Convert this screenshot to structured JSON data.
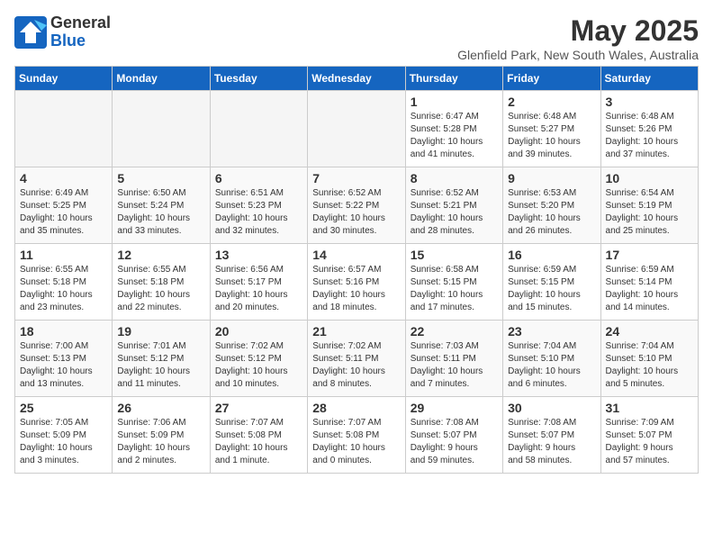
{
  "logo": {
    "general": "General",
    "blue": "Blue"
  },
  "title": "May 2025",
  "location": "Glenfield Park, New South Wales, Australia",
  "days_of_week": [
    "Sunday",
    "Monday",
    "Tuesday",
    "Wednesday",
    "Thursday",
    "Friday",
    "Saturday"
  ],
  "weeks": [
    [
      {
        "day": "",
        "info": ""
      },
      {
        "day": "",
        "info": ""
      },
      {
        "day": "",
        "info": ""
      },
      {
        "day": "",
        "info": ""
      },
      {
        "day": "1",
        "info": "Sunrise: 6:47 AM\nSunset: 5:28 PM\nDaylight: 10 hours\nand 41 minutes."
      },
      {
        "day": "2",
        "info": "Sunrise: 6:48 AM\nSunset: 5:27 PM\nDaylight: 10 hours\nand 39 minutes."
      },
      {
        "day": "3",
        "info": "Sunrise: 6:48 AM\nSunset: 5:26 PM\nDaylight: 10 hours\nand 37 minutes."
      }
    ],
    [
      {
        "day": "4",
        "info": "Sunrise: 6:49 AM\nSunset: 5:25 PM\nDaylight: 10 hours\nand 35 minutes."
      },
      {
        "day": "5",
        "info": "Sunrise: 6:50 AM\nSunset: 5:24 PM\nDaylight: 10 hours\nand 33 minutes."
      },
      {
        "day": "6",
        "info": "Sunrise: 6:51 AM\nSunset: 5:23 PM\nDaylight: 10 hours\nand 32 minutes."
      },
      {
        "day": "7",
        "info": "Sunrise: 6:52 AM\nSunset: 5:22 PM\nDaylight: 10 hours\nand 30 minutes."
      },
      {
        "day": "8",
        "info": "Sunrise: 6:52 AM\nSunset: 5:21 PM\nDaylight: 10 hours\nand 28 minutes."
      },
      {
        "day": "9",
        "info": "Sunrise: 6:53 AM\nSunset: 5:20 PM\nDaylight: 10 hours\nand 26 minutes."
      },
      {
        "day": "10",
        "info": "Sunrise: 6:54 AM\nSunset: 5:19 PM\nDaylight: 10 hours\nand 25 minutes."
      }
    ],
    [
      {
        "day": "11",
        "info": "Sunrise: 6:55 AM\nSunset: 5:18 PM\nDaylight: 10 hours\nand 23 minutes."
      },
      {
        "day": "12",
        "info": "Sunrise: 6:55 AM\nSunset: 5:18 PM\nDaylight: 10 hours\nand 22 minutes."
      },
      {
        "day": "13",
        "info": "Sunrise: 6:56 AM\nSunset: 5:17 PM\nDaylight: 10 hours\nand 20 minutes."
      },
      {
        "day": "14",
        "info": "Sunrise: 6:57 AM\nSunset: 5:16 PM\nDaylight: 10 hours\nand 18 minutes."
      },
      {
        "day": "15",
        "info": "Sunrise: 6:58 AM\nSunset: 5:15 PM\nDaylight: 10 hours\nand 17 minutes."
      },
      {
        "day": "16",
        "info": "Sunrise: 6:59 AM\nSunset: 5:15 PM\nDaylight: 10 hours\nand 15 minutes."
      },
      {
        "day": "17",
        "info": "Sunrise: 6:59 AM\nSunset: 5:14 PM\nDaylight: 10 hours\nand 14 minutes."
      }
    ],
    [
      {
        "day": "18",
        "info": "Sunrise: 7:00 AM\nSunset: 5:13 PM\nDaylight: 10 hours\nand 13 minutes."
      },
      {
        "day": "19",
        "info": "Sunrise: 7:01 AM\nSunset: 5:12 PM\nDaylight: 10 hours\nand 11 minutes."
      },
      {
        "day": "20",
        "info": "Sunrise: 7:02 AM\nSunset: 5:12 PM\nDaylight: 10 hours\nand 10 minutes."
      },
      {
        "day": "21",
        "info": "Sunrise: 7:02 AM\nSunset: 5:11 PM\nDaylight: 10 hours\nand 8 minutes."
      },
      {
        "day": "22",
        "info": "Sunrise: 7:03 AM\nSunset: 5:11 PM\nDaylight: 10 hours\nand 7 minutes."
      },
      {
        "day": "23",
        "info": "Sunrise: 7:04 AM\nSunset: 5:10 PM\nDaylight: 10 hours\nand 6 minutes."
      },
      {
        "day": "24",
        "info": "Sunrise: 7:04 AM\nSunset: 5:10 PM\nDaylight: 10 hours\nand 5 minutes."
      }
    ],
    [
      {
        "day": "25",
        "info": "Sunrise: 7:05 AM\nSunset: 5:09 PM\nDaylight: 10 hours\nand 3 minutes."
      },
      {
        "day": "26",
        "info": "Sunrise: 7:06 AM\nSunset: 5:09 PM\nDaylight: 10 hours\nand 2 minutes."
      },
      {
        "day": "27",
        "info": "Sunrise: 7:07 AM\nSunset: 5:08 PM\nDaylight: 10 hours\nand 1 minute."
      },
      {
        "day": "28",
        "info": "Sunrise: 7:07 AM\nSunset: 5:08 PM\nDaylight: 10 hours\nand 0 minutes."
      },
      {
        "day": "29",
        "info": "Sunrise: 7:08 AM\nSunset: 5:07 PM\nDaylight: 9 hours\nand 59 minutes."
      },
      {
        "day": "30",
        "info": "Sunrise: 7:08 AM\nSunset: 5:07 PM\nDaylight: 9 hours\nand 58 minutes."
      },
      {
        "day": "31",
        "info": "Sunrise: 7:09 AM\nSunset: 5:07 PM\nDaylight: 9 hours\nand 57 minutes."
      }
    ]
  ]
}
